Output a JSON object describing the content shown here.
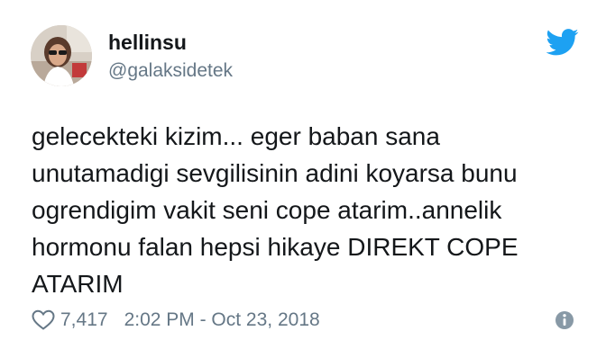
{
  "user": {
    "display_name": "hellinsu",
    "handle": "@galaksidetek"
  },
  "tweet": {
    "text": "gelecekteki kizim... eger baban sana\nunutamadigi sevgilisinin adini koyarsa bunu\nogrendigim vakit seni cope atarim..annelik\nhormonu falan hepsi hikaye DIREKT COPE\nATARIM"
  },
  "footer": {
    "likes": "7,417",
    "timestamp": "2:02 PM - Oct 23, 2018"
  },
  "icons": {
    "brand": "twitter-bird-icon",
    "like": "heart-icon",
    "info": "info-icon"
  },
  "colors": {
    "brand_blue": "#1da1f2",
    "text": "#14171a",
    "secondary": "#657786"
  }
}
